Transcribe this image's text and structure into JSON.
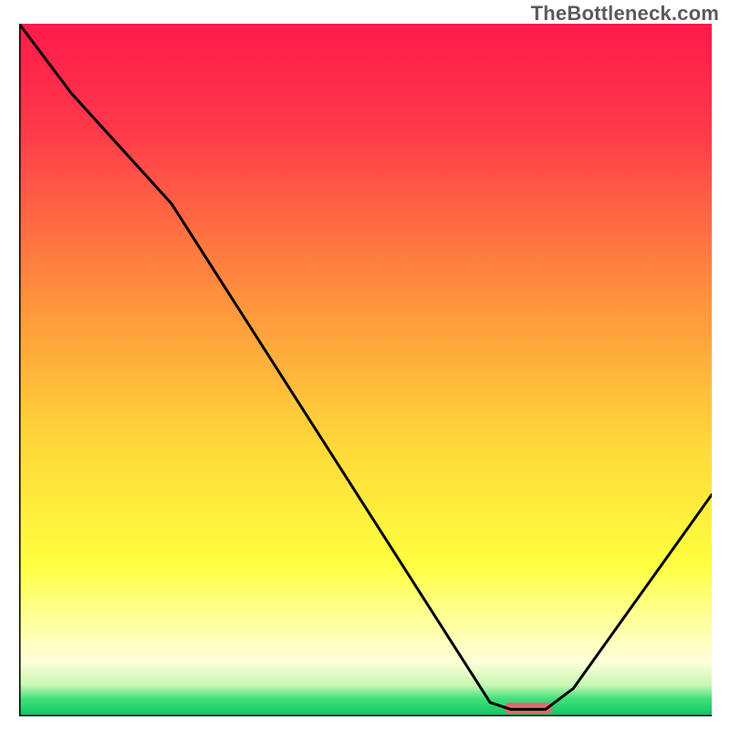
{
  "watermark": "TheBottleneck.com",
  "chart_data": {
    "type": "line",
    "title": "",
    "xlabel": "",
    "ylabel": "",
    "xlim": [
      0,
      100
    ],
    "ylim": [
      0,
      100
    ],
    "grid": false,
    "background_gradient": {
      "stops": [
        {
          "offset": 0.0,
          "color": "#ff1a4b"
        },
        {
          "offset": 0.15,
          "color": "#ff384a"
        },
        {
          "offset": 0.4,
          "color": "#ff933d"
        },
        {
          "offset": 0.6,
          "color": "#ffd63a"
        },
        {
          "offset": 0.78,
          "color": "#ffff3f"
        },
        {
          "offset": 0.86,
          "color": "#ffff9a"
        },
        {
          "offset": 0.92,
          "color": "#ffffd9"
        },
        {
          "offset": 0.955,
          "color": "#c8f7b3"
        },
        {
          "offset": 0.975,
          "color": "#41e07a"
        },
        {
          "offset": 1.0,
          "color": "#09c565"
        }
      ]
    },
    "series": [
      {
        "name": "bottleneck-curve",
        "x": [
          0,
          7.5,
          22,
          68,
          71,
          76,
          80,
          100
        ],
        "values": [
          100,
          90,
          74,
          2,
          1,
          1,
          4,
          32
        ],
        "stroke": "#000000"
      }
    ],
    "marker": {
      "name": "optimal-range",
      "x": 73.5,
      "y": 1.2,
      "width": 7,
      "color": "#e16a6c"
    },
    "axes_color": "#000000"
  }
}
